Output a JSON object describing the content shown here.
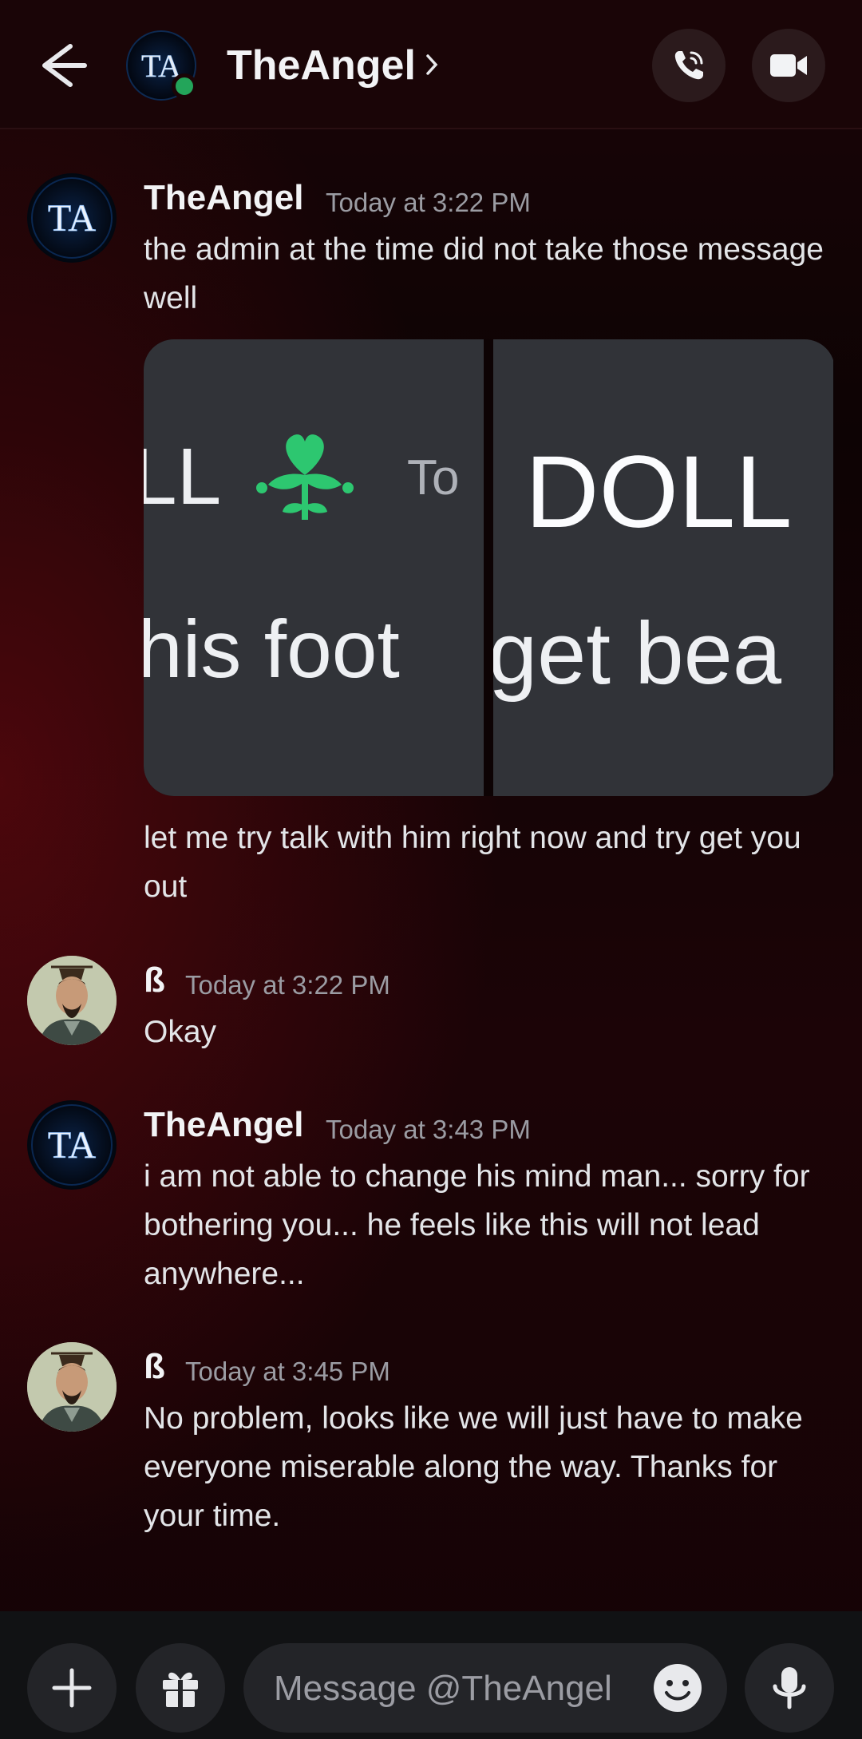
{
  "header": {
    "title": "TheAngel",
    "back_icon": "arrow-left-icon",
    "call_icon": "phone-icon",
    "video_icon": "video-camera-icon",
    "presence": "online"
  },
  "messages": [
    {
      "author": "TheAngel",
      "avatar_text": "TA",
      "timestamp": "Today at 3:22 PM",
      "text": "the admin at the time did not take those message well",
      "attachments": {
        "left": {
          "line1": "LL",
          "line1b": "To",
          "line2": "his foot"
        },
        "right": {
          "line1": "DOLL",
          "line2": "get bea"
        }
      },
      "followup_text": "let me try talk with him right now and try get you out"
    },
    {
      "author": "ß",
      "timestamp": "Today at 3:22 PM",
      "text": "Okay"
    },
    {
      "author": "TheAngel",
      "avatar_text": "TA",
      "timestamp": "Today at 3:43 PM",
      "text": "i am not able to change his mind man... sorry for bothering you... he feels like this will not lead anywhere..."
    },
    {
      "author": "ß",
      "timestamp": "Today at 3:45 PM",
      "text": "No problem, looks like we will just have to make everyone miserable along the way. Thanks for your time."
    }
  ],
  "composer": {
    "placeholder": "Message @TheAngel",
    "plus_icon": "plus-icon",
    "gift_icon": "gift-icon",
    "emoji_icon": "emoji-icon",
    "mic_icon": "microphone-icon"
  },
  "colors": {
    "online": "#23a55a",
    "text": "#f2f3f5",
    "muted": "#9b9ca3",
    "emoji_green": "#2dc770"
  }
}
